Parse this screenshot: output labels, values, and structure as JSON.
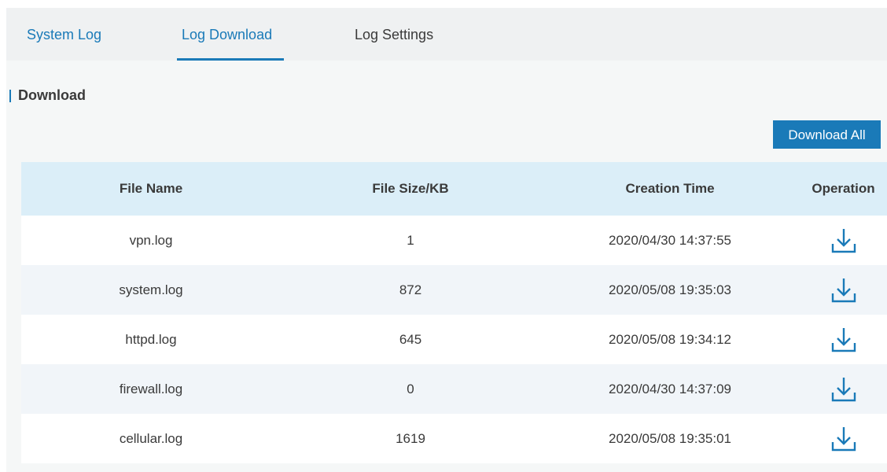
{
  "tabs": [
    {
      "label": "System Log"
    },
    {
      "label": "Log Download"
    },
    {
      "label": "Log Settings"
    }
  ],
  "section": {
    "title": "Download"
  },
  "toolbar": {
    "download_all_label": "Download All"
  },
  "table": {
    "headers": {
      "file_name": "File Name",
      "file_size": "File Size/KB",
      "creation_time": "Creation Time",
      "operation": "Operation"
    },
    "rows": [
      {
        "name": "vpn.log",
        "size": "1",
        "time": "2020/04/30 14:37:55",
        "icon": "download-icon"
      },
      {
        "name": "system.log",
        "size": "872",
        "time": "2020/05/08 19:35:03",
        "icon": "download-icon"
      },
      {
        "name": "httpd.log",
        "size": "645",
        "time": "2020/05/08 19:34:12",
        "icon": "download-icon"
      },
      {
        "name": "firewall.log",
        "size": "0",
        "time": "2020/04/30 14:37:09",
        "icon": "download-icon"
      },
      {
        "name": "cellular.log",
        "size": "1619",
        "time": "2020/05/08 19:35:01",
        "icon": "download-icon"
      }
    ]
  },
  "colors": {
    "accent": "#1a7ab8",
    "header_bg": "#dbeef8",
    "tab_bar_bg": "#eff1f2",
    "page_bg": "#f5f7f7"
  }
}
